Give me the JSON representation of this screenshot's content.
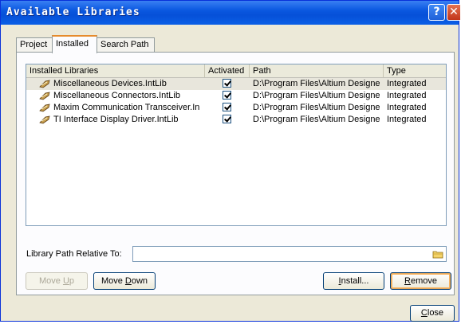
{
  "window": {
    "title": "Available Libraries"
  },
  "tabs": [
    {
      "label": "Project",
      "active": false
    },
    {
      "label": "Installed",
      "active": true
    },
    {
      "label": "Search Path",
      "active": false
    }
  ],
  "table": {
    "columns": [
      "Installed Libraries",
      "Activated",
      "Path",
      "Type"
    ],
    "rows": [
      {
        "name": "Miscellaneous Devices.IntLib",
        "activated": true,
        "path": "D:\\Program Files\\Altium Designe",
        "type": "Integrated"
      },
      {
        "name": "Miscellaneous Connectors.IntLib",
        "activated": true,
        "path": "D:\\Program Files\\Altium Designe",
        "type": "Integrated"
      },
      {
        "name": "Maxim Communication Transceiver.In",
        "activated": true,
        "path": "D:\\Program Files\\Altium Designe",
        "type": "Integrated"
      },
      {
        "name": "TI Interface Display Driver.IntLib",
        "activated": true,
        "path": "D:\\Program Files\\Altium Designe",
        "type": "Integrated"
      }
    ]
  },
  "library_path": {
    "label": "Library Path Relative To:",
    "value": ""
  },
  "buttons": {
    "move_up": {
      "pre": "Move ",
      "key": "U",
      "post": "p"
    },
    "move_down": {
      "pre": "Move ",
      "key": "D",
      "post": "own"
    },
    "install": {
      "pre": "",
      "key": "I",
      "post": "nstall..."
    },
    "remove": {
      "pre": "",
      "key": "R",
      "post": "emove"
    },
    "close": {
      "pre": "",
      "key": "C",
      "post": "lose"
    }
  },
  "colors": {
    "title_bar": "#0a58e0",
    "tab_accent": "#e68b2c",
    "selected_row": "#e8e6dc"
  }
}
